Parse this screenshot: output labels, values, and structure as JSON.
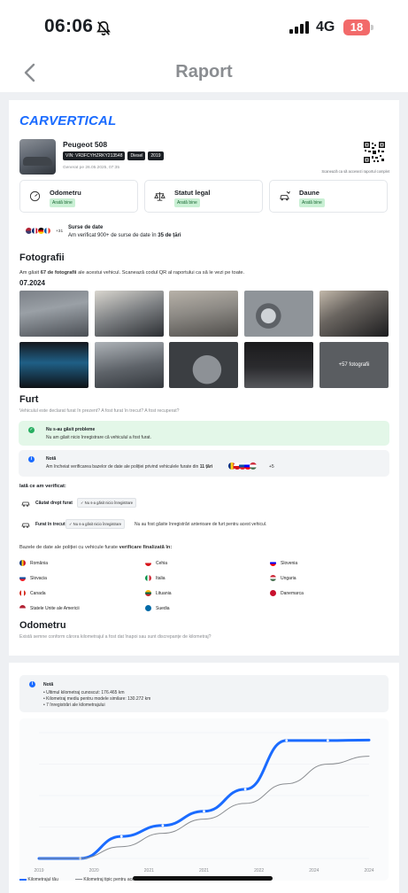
{
  "status_bar": {
    "time": "06:06",
    "network": "4G",
    "battery": "18"
  },
  "nav": {
    "title": "Raport"
  },
  "report": {
    "brand": "CARVERTICAL",
    "car_name": "Peugeot 508",
    "chips": [
      "VIN: VR3FCYHZRKY213548",
      "Diesel",
      "2019"
    ],
    "generated": "Generat pe 26.05.2025, 07:35",
    "qr_note": "Scanează ca să accesezi raportul complet",
    "summary": [
      {
        "title": "Odometru",
        "badge": "Arată bine",
        "icon": "gauge-icon"
      },
      {
        "title": "Statut legal",
        "badge": "Arată bine",
        "icon": "scales-icon"
      },
      {
        "title": "Daune",
        "badge": "Arată bine",
        "icon": "car-crash-icon"
      }
    ],
    "sources": {
      "flags_more": "+31",
      "title": "Surse de date",
      "desc_pre": "Am verificat 900+ de surse de date în ",
      "desc_bold": "35 de țări"
    }
  },
  "photos": {
    "title": "Fotografii",
    "desc_pre": "Am găsit ",
    "desc_bold": "67 de fotografii",
    "desc_post": " ale acestui vehicul. Scanează codul QR al raportului ca să le vezi pe toate.",
    "date": "07.2024",
    "more": "+57 fotografii"
  },
  "theft": {
    "title": "Furt",
    "subtitle": "Vehiculul este declarat furat în prezent? A fost furat în trecut? A fost recuperat?",
    "ok_title": "Nu s-au găsit probleme",
    "ok_desc": "Nu am găsit nicio înregistrare că vehiculul a fost furat.",
    "note_title": "Notă",
    "note_desc_pre": "Am încheiat verificarea bazelor de date ale poliției privind vehiculele furate din ",
    "note_desc_bold": "11 țări",
    "note_more": "+5",
    "checked_title": "Iată ce am verificat:",
    "checks": [
      {
        "label": "Căutat drept furat",
        "badge": "✓ Nu s-a găsit nicio înregistrare",
        "note": ""
      },
      {
        "label": "Furat în trecut",
        "badge": "✓ Nu s-a găsit nicio înregistrare",
        "note": "Nu au fost găsite înregistrări anterioare de furt pentru acest vehicul."
      }
    ],
    "db_title_pre": "Bazele de date ale poliției cu vehicule furate ",
    "db_title_bold": "verificare finalizată în:",
    "countries": [
      [
        "România",
        "Cehia",
        "Slovenia"
      ],
      [
        "Slovacia",
        "Italia",
        "Ungaria"
      ],
      [
        "Canada",
        "Lituania",
        "Danemarca"
      ],
      [
        "Statele Unite ale Americii",
        "Suedia",
        ""
      ]
    ]
  },
  "odometer": {
    "title": "Odometru",
    "subtitle": "Există semne conform cărora kilometrajul a fost dat înapoi sau sunt discrepanțe de kilometraj?",
    "note_title": "Notă",
    "note_items": [
      "Ultimul kilometraj cunoscut: 176.465 km",
      "Kilometraj mediu pentru modele similare: 130.272 km",
      "7 înregistrări ale kilometrajului"
    ]
  },
  "chart_data": {
    "type": "line",
    "x_ticks": [
      "2019",
      "2020",
      "2021",
      "2021",
      "2022",
      "2024",
      "2024"
    ],
    "series": [
      {
        "name": "Kilometrajul tău",
        "color": "#1a6bff",
        "values": [
          0,
          0,
          28000,
          42000,
          60000,
          88000,
          150000,
          150000,
          150500
        ]
      },
      {
        "name": "Kilometraj tipic pentru acest model",
        "color": "#8a8d91",
        "values": [
          0,
          0,
          15000,
          32000,
          50000,
          70000,
          95000,
          120000,
          130000
        ]
      }
    ]
  },
  "colors": {
    "accent": "#1a6bff",
    "ok_bg": "#e3f7e8",
    "ok_badge": "#c9f0d4",
    "note_bg": "#f2f4f6"
  }
}
